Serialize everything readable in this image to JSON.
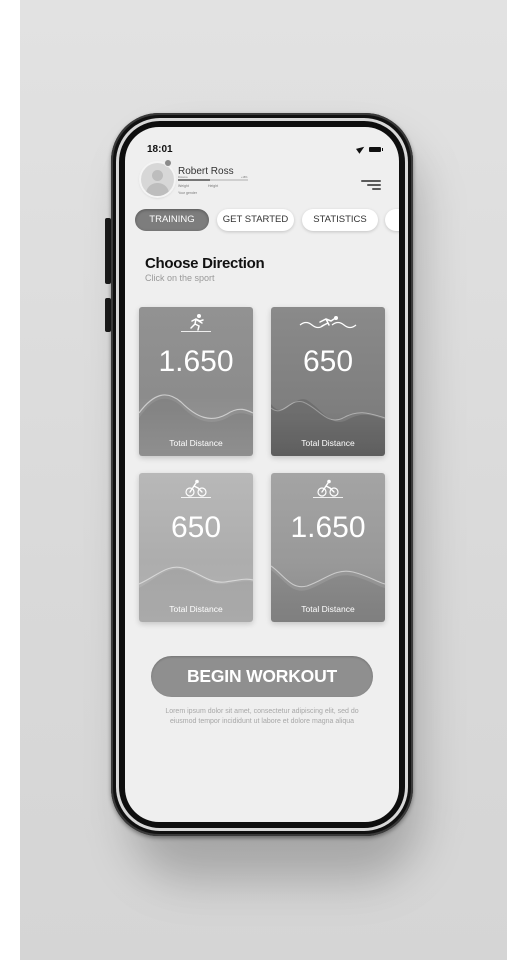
{
  "status_bar": {
    "time": "18:01"
  },
  "profile": {
    "name": "Robert Ross",
    "progress_label": "Distance",
    "progress_percent": "+18%",
    "progress_fraction": 0.45,
    "weight_label": "Weight",
    "height_label": "Height",
    "gender_label": "Your gender"
  },
  "tabs": [
    {
      "label": "TRAINING",
      "active": true
    },
    {
      "label": "GET STARTED",
      "active": false
    },
    {
      "label": "STATISTICS",
      "active": false
    }
  ],
  "section": {
    "title": "Choose Direction",
    "subtitle": "Click on the sport"
  },
  "cards": [
    {
      "sport": "running",
      "icon": "runner-icon",
      "value": "1.650",
      "label": "Total Distance"
    },
    {
      "sport": "swimming",
      "icon": "swimmer-icon",
      "value": "650",
      "label": "Total Distance"
    },
    {
      "sport": "cycling",
      "icon": "cyclist-icon",
      "value": "650",
      "label": "Total Distance"
    },
    {
      "sport": "cycling",
      "icon": "cyclist-icon",
      "value": "1.650",
      "label": "Total Distance"
    }
  ],
  "cta": {
    "label": "BEGIN WORKOUT",
    "description": "Lorem ipsum dolor sit amet, consectetur adipiscing elit, sed do eiusmod tempor incididunt ut labore et dolore magna aliqua"
  },
  "colors": {
    "card_dark": "#8a8a8a",
    "card_light": "#b0b0b0",
    "button": "#8f8f8f",
    "active_tab": "#7d7d7d"
  }
}
